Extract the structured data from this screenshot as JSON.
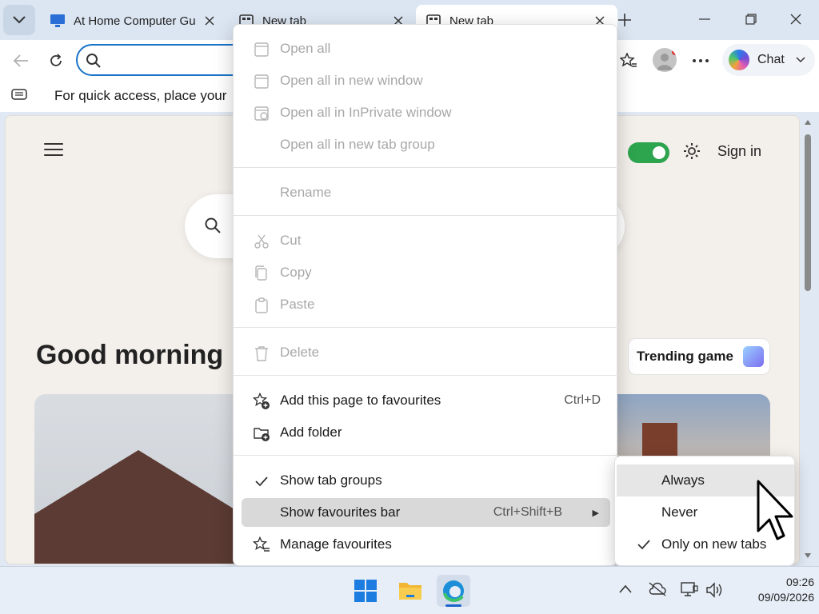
{
  "tabs": [
    {
      "title": "At Home Computer Guides",
      "active": false
    },
    {
      "title": "New tab",
      "active": false
    },
    {
      "title": "New tab",
      "active": true
    }
  ],
  "toolbar": {
    "chat_label": "Chat"
  },
  "favbar": {
    "prompt_text": "For quick access, place your favourites here on the favourites bar."
  },
  "page": {
    "signin_label": "Sign in",
    "greeting": "Good morning",
    "trending_label": "Trending game"
  },
  "menu": {
    "items": [
      {
        "label": "Open all",
        "disabled": true
      },
      {
        "label": "Open all in new window",
        "disabled": true
      },
      {
        "label": "Open all in InPrivate window",
        "disabled": true
      },
      {
        "label": "Open all in new tab group",
        "disabled": true
      },
      {
        "label": "Rename",
        "disabled": true
      },
      {
        "label": "Cut",
        "disabled": true
      },
      {
        "label": "Copy",
        "disabled": true
      },
      {
        "label": "Paste",
        "disabled": true
      },
      {
        "label": "Delete",
        "disabled": true
      },
      {
        "label": "Add this page to favourites",
        "shortcut": "Ctrl+D"
      },
      {
        "label": "Add folder"
      },
      {
        "label": "Show tab groups",
        "checked": true
      },
      {
        "label": "Show favourites bar",
        "shortcut": "Ctrl+Shift+B",
        "highlighted": true,
        "submenu": true
      },
      {
        "label": "Manage favourites"
      }
    ]
  },
  "submenu": {
    "items": [
      {
        "label": "Always",
        "highlighted": true
      },
      {
        "label": "Never"
      },
      {
        "label": "Only on new tabs",
        "checked": true
      }
    ]
  },
  "taskbar": {
    "time": "09:26",
    "date": "09/09/2026"
  },
  "colors": {
    "accent": "#1a73c9",
    "toggle_on": "#2da44e",
    "menu_highlight": "#d9d9d9"
  }
}
